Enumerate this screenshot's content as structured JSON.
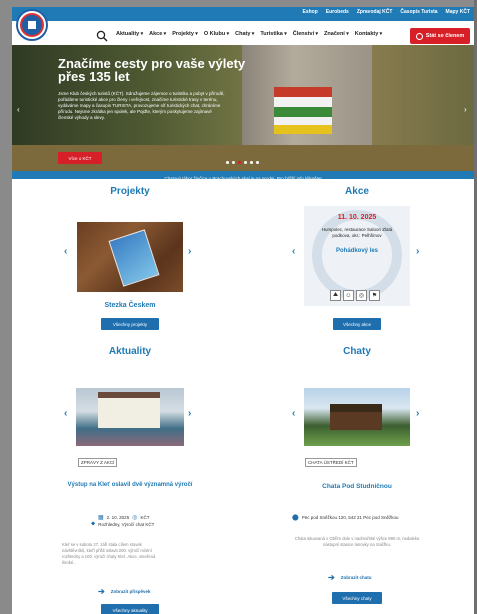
{
  "toplinks": [
    "Eshop",
    "Eurobeds",
    "Zpravodaj KČT",
    "Časopis Turista",
    "Mapy KČT"
  ],
  "nav": {
    "items": [
      "Aktuality",
      "Akce",
      "Projekty",
      "O Klubu",
      "Chaty",
      "Turistika",
      "Členství",
      "Značení",
      "Kontakty"
    ],
    "member_button": "Stát se členem"
  },
  "hero": {
    "title": "Značíme cesty pro vaše výlety přes 135 let",
    "text": "Jsme Klub českých turistů (KČT). Sdružujeme zájemce o turistiku a pobyt v přírodě, pořádáme turistické akce pro členy i veřejnost, značíme turistické trasy v terénu, vydáváme mapy a časopis TURISTA, provozujeme síť turistických chat, chráníme přírodu. Nejsme zkrátka jen spolek, ale Pojďte, kterým poskytujeme zajímavé členské výhody a slevy.",
    "button": "Více o KČT",
    "arrow_left": "‹",
    "arrow_right": "›"
  },
  "notice": "Chatový tábor žinčice u Prachovských skal je na prodej. Pro bližší info klikněte!",
  "projekty": {
    "title": "Projekty",
    "item_name": "Stezka Českem",
    "button": "Všechny projekty"
  },
  "akce": {
    "title": "Akce",
    "date": "11. 10. 2025",
    "place": "Humpolec, restaurace Saloon Zlatá podkova, okr.: Pelhřimov",
    "name": "Pohádkový les",
    "button": "Všechny akce"
  },
  "aktuality": {
    "title": "Aktuality",
    "tag": "ZPRÁVY Z AKCÍ",
    "item_title": "Výstup na Kleť oslavil dvě významná výročí",
    "date": "2. 10. 2025",
    "author": "KČT",
    "categories": "Rozhledny, Výročí chat KČT",
    "text": "Kleť se v sobotu 27. září stala cílem stovek návštěvníků, kteří přišli oslavit 200. výročí místní rozhledny a 100. výročí chaty Kleť. Akce, otevřená široké...",
    "link": "Zobrazit příspěvek",
    "button": "Všechny aktuality"
  },
  "chaty": {
    "title": "Chaty",
    "tag": "CHATA ÚSTŘEDÍ KČT",
    "item_name": "Chata Pod Studničnou",
    "address": "Pec pod Sněžkou 120, 542 21 Pec pod Sněžkou",
    "text": "Chata situovaná v Obřím dole v nadmořské výšce 890 m, nedaleko nástupní stanice lanovky na Sněžku.",
    "link": "Zobrazit chatu",
    "button": "Všechny chaty"
  },
  "colors": {
    "primary": "#1f7ab5",
    "accent": "#d61f26"
  }
}
